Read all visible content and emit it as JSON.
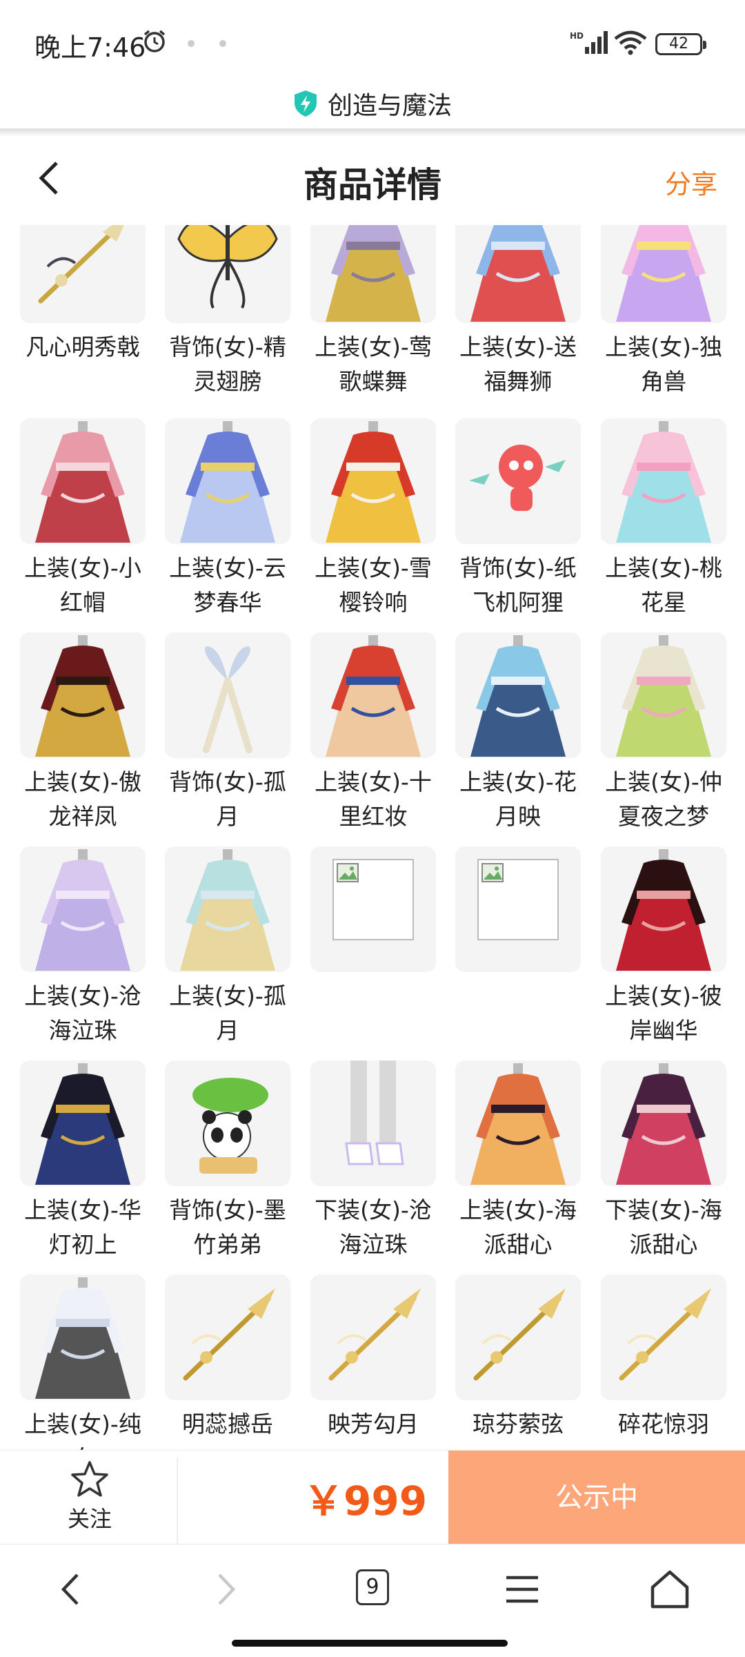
{
  "status_bar": {
    "time": "晚上7:46",
    "battery": "42"
  },
  "browser": {
    "site_name": "创造与魔法",
    "tab_count": "9"
  },
  "header": {
    "title": "商品详情",
    "share": "分享"
  },
  "items": [
    {
      "label": "凡心明秀戟",
      "icon": "halberd-weapon"
    },
    {
      "label": "背饰(女)-精灵翅膀",
      "icon": "butterfly-wings"
    },
    {
      "label": "上装(女)-莺歌蝶舞",
      "icon": "gold-armor-outfit"
    },
    {
      "label": "上装(女)-送福舞狮",
      "icon": "lion-dance-costume"
    },
    {
      "label": "上装(女)-独角兽",
      "icon": "unicorn-winged-outfit"
    },
    {
      "label": "上装(女)-小红帽",
      "icon": "red-riding-hood-dress"
    },
    {
      "label": "上装(女)-云梦春华",
      "icon": "blue-robe-outfit"
    },
    {
      "label": "上装(女)-雪樱铃响",
      "icon": "red-kimono-outfit"
    },
    {
      "label": "背饰(女)-纸飞机阿狸",
      "icon": "ali-fox-paper-plane"
    },
    {
      "label": "上装(女)-桃花星",
      "icon": "pink-flower-dress"
    },
    {
      "label": "上装(女)-傲龙祥凤",
      "icon": "dragon-phoenix-robe"
    },
    {
      "label": "背饰(女)-孤月",
      "icon": "ribbon-back-accessory"
    },
    {
      "label": "上装(女)-十里红妆",
      "icon": "red-wedding-robe"
    },
    {
      "label": "上装(女)-花月映",
      "icon": "blue-lace-dress"
    },
    {
      "label": "上装(女)-仲夏夜之梦",
      "icon": "floral-fairy-dress"
    },
    {
      "label": "上装(女)-沧海泣珠",
      "icon": "lavender-gown"
    },
    {
      "label": "上装(女)-孤月",
      "icon": "aqua-robe"
    },
    {
      "label": "",
      "icon": "broken-image"
    },
    {
      "label": "",
      "icon": "broken-image"
    },
    {
      "label": "上装(女)-彼岸幽华",
      "icon": "black-red-kimono"
    },
    {
      "label": "上装(女)-华灯初上",
      "icon": "fur-collar-qipao"
    },
    {
      "label": "背饰(女)-墨竹弟弟",
      "icon": "panda-leaf-umbrella"
    },
    {
      "label": "下装(女)-沧海泣珠",
      "icon": "silver-boots"
    },
    {
      "label": "上装(女)-海派甜心",
      "icon": "sweetheart-top"
    },
    {
      "label": "下装(女)-海派甜心",
      "icon": "plaid-skirt"
    },
    {
      "label": "上装(女)-纯白",
      "icon": "white-snow-gown"
    },
    {
      "label": "明蕊撼岳",
      "icon": "golden-sword"
    },
    {
      "label": "映芳勾月",
      "icon": "golden-staff"
    },
    {
      "label": "琼芬萦弦",
      "icon": "golden-bow"
    },
    {
      "label": "碎花惊羽",
      "icon": "golden-crossbow"
    }
  ],
  "bottom_bar": {
    "follow_label": "关注",
    "price": "￥999",
    "status_button": "公示中"
  },
  "colors": {
    "accent": "#f07a22",
    "price": "#f35a17",
    "status_button_bg": "#fda679"
  }
}
